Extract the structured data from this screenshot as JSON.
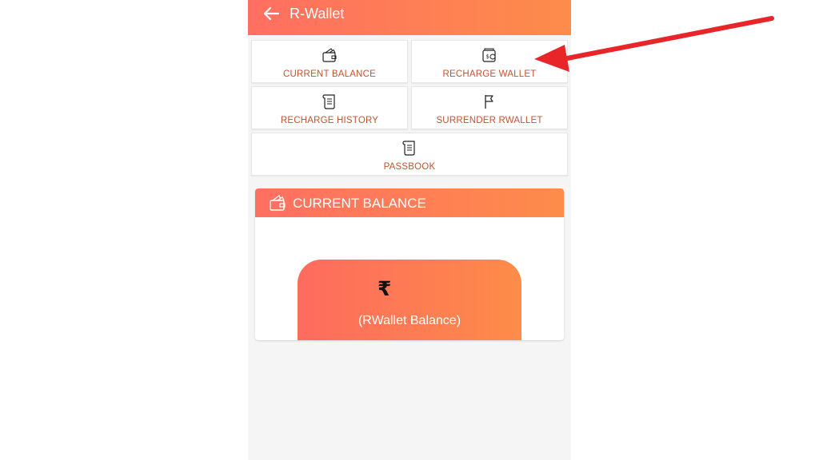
{
  "app": {
    "title": "R-Wallet"
  },
  "tiles": {
    "current_balance": "CURRENT BALANCE",
    "recharge_wallet": "RECHARGE WALLET",
    "recharge_history": "RECHARGE HISTORY",
    "surrender_rwallet": "SURRENDER RWALLET",
    "passbook": "PASSBOOK"
  },
  "balance_card": {
    "title": "CURRENT BALANCE",
    "currency_symbol": "₹",
    "amount": "",
    "caption": "(RWallet Balance)"
  },
  "icons": {
    "back": "back-arrow-icon",
    "current_balance": "wallet-icon",
    "recharge_wallet": "wallet-recharge-icon",
    "recharge_history": "scroll-icon",
    "surrender_rwallet": "flag-icon",
    "passbook": "scroll-icon",
    "card_header": "wallet-icon"
  },
  "colors": {
    "accent_start": "#ff6f61",
    "accent_end": "#fd8c4b",
    "label": "#c4522e",
    "annotation_arrow": "#e8262a"
  }
}
